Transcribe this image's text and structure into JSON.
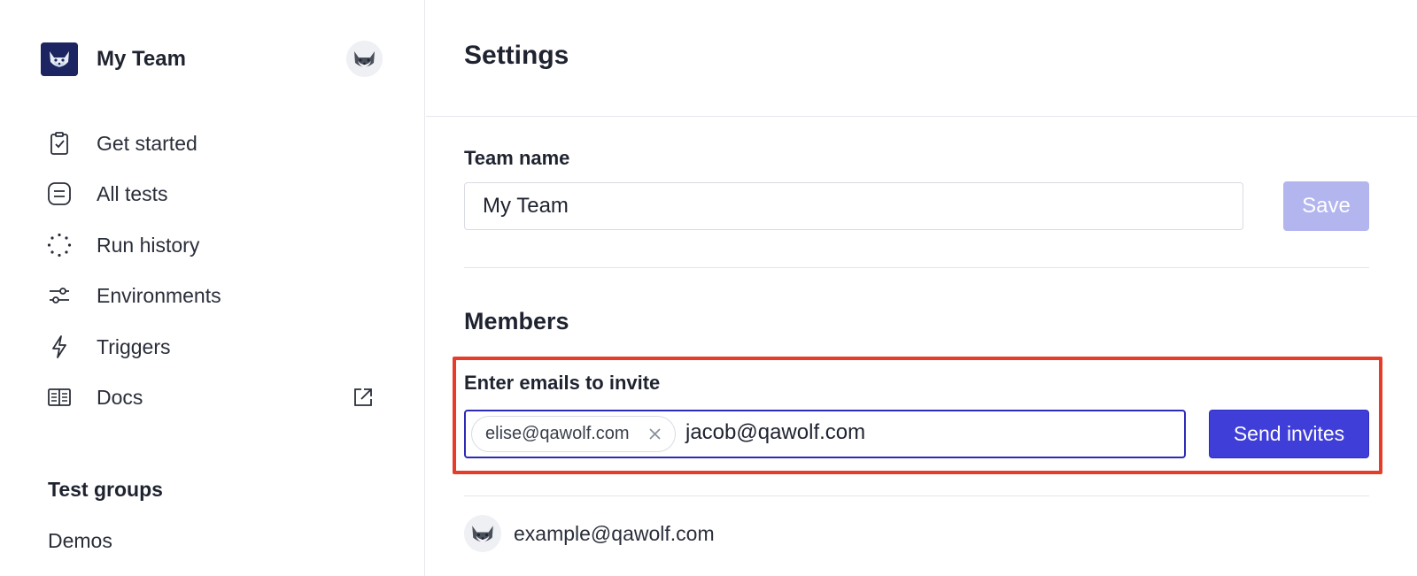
{
  "colors": {
    "accent": "#3f3ed8",
    "accent_disabled": "#b3b5ef",
    "highlight": "#e53d2a",
    "text": "#1f2330"
  },
  "sidebar": {
    "team_name": "My Team",
    "team_logo_icon": "wolf-logo-icon",
    "user_avatar_icon": "husky-avatar-icon",
    "nav_items": [
      {
        "label": "Get started",
        "icon": "clipboard-check-icon"
      },
      {
        "label": "All tests",
        "icon": "list-icon"
      },
      {
        "label": "Run history",
        "icon": "dotted-circle-icon"
      },
      {
        "label": "Environments",
        "icon": "sliders-icon"
      },
      {
        "label": "Triggers",
        "icon": "lightning-icon"
      },
      {
        "label": "Docs",
        "icon": "book-icon",
        "external_icon": "external-link-icon"
      }
    ],
    "section_title": "Test groups",
    "groups": [
      {
        "label": "Demos"
      }
    ]
  },
  "main": {
    "title": "Settings",
    "team_name_section": {
      "label": "Team name",
      "value": "My Team",
      "save_label": "Save"
    },
    "members": {
      "title": "Members",
      "invite_label": "Enter emails to invite",
      "chips": [
        {
          "email": "elise@qawolf.com"
        }
      ],
      "input_value": "jacob@qawolf.com",
      "send_label": "Send invites",
      "list": [
        {
          "email": "example@qawolf.com"
        }
      ]
    }
  }
}
